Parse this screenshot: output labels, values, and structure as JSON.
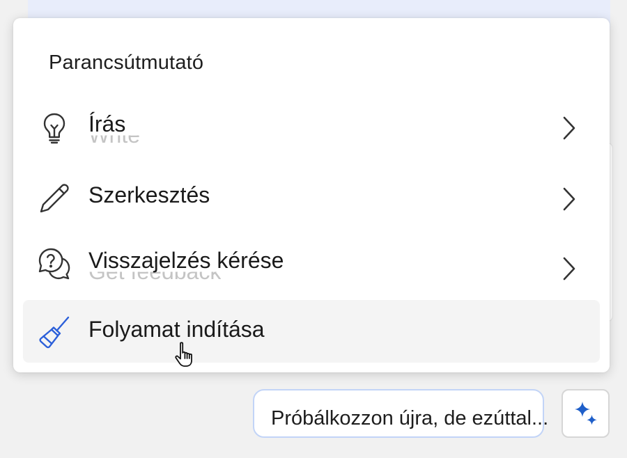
{
  "popup": {
    "title": "Parancsútmutató",
    "items": [
      {
        "label": "Írás",
        "ghost_label": "Write",
        "icon": "lightbulb-icon",
        "has_submenu": true
      },
      {
        "label": "Szerkesztés",
        "ghost_label": "",
        "icon": "pencil-icon",
        "has_submenu": true
      },
      {
        "label": "Visszajelzés kérése",
        "ghost_label": "Get feedback",
        "icon": "question-chat-icon",
        "has_submenu": true
      },
      {
        "label": "Folyamat indítása",
        "ghost_label": "",
        "icon": "broom-icon",
        "has_submenu": false
      }
    ]
  },
  "suggestion": {
    "text": "Próbálkozzon újra, de ezúttal..."
  },
  "colors": {
    "accent": "#2b5fd9",
    "hover_bg": "#f4f4f4",
    "suggestion_border": "#c2d4f7"
  }
}
